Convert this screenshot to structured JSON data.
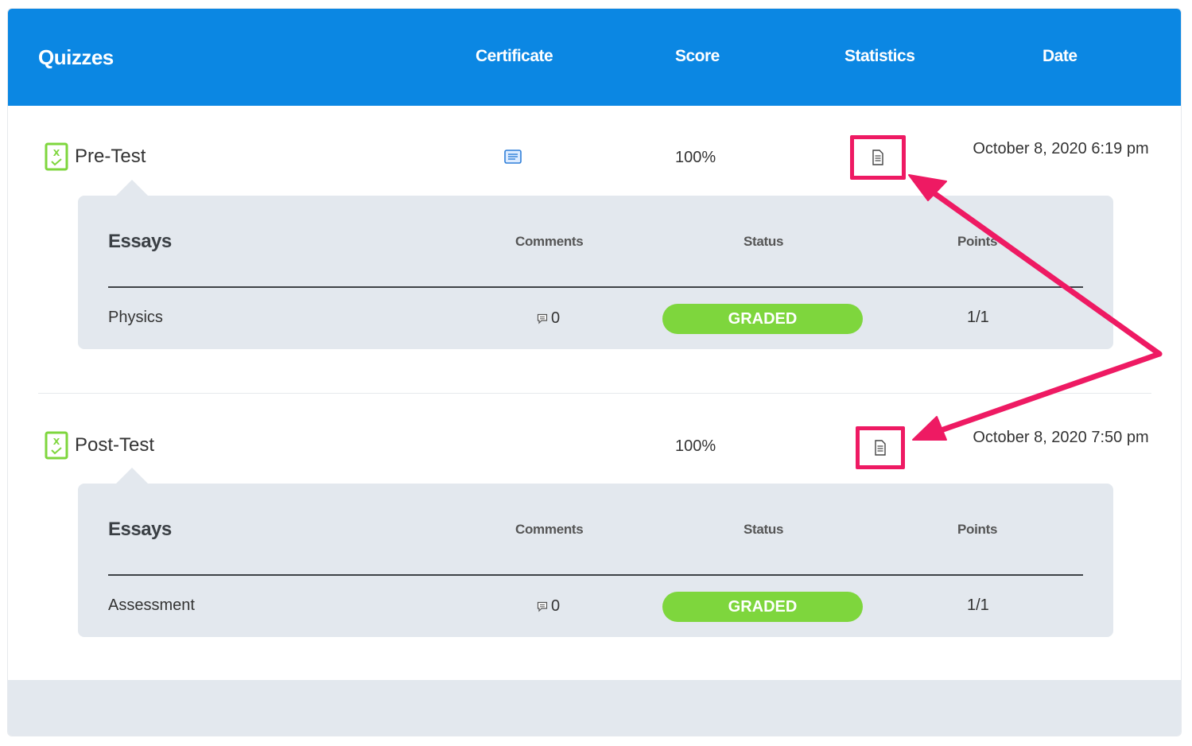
{
  "header": {
    "title": "Quizzes",
    "col_certificate": "Certificate",
    "col_score": "Score",
    "col_statistics": "Statistics",
    "col_date": "Date"
  },
  "quizzes": [
    {
      "name": "Pre-Test",
      "has_certificate": true,
      "score": "100%",
      "date": "October 8, 2020 6:19 pm",
      "essays": {
        "title": "Essays",
        "col_comments": "Comments",
        "col_status": "Status",
        "col_points": "Points",
        "rows": [
          {
            "name": "Physics",
            "comments": "0",
            "status": "GRADED",
            "points": "1/1"
          }
        ]
      }
    },
    {
      "name": "Post-Test",
      "has_certificate": false,
      "score": "100%",
      "date": "October 8, 2020 7:50 pm",
      "essays": {
        "title": "Essays",
        "col_comments": "Comments",
        "col_status": "Status",
        "col_points": "Points",
        "rows": [
          {
            "name": "Assessment",
            "comments": "0",
            "status": "GRADED",
            "points": "1/1"
          }
        ]
      }
    }
  ],
  "colors": {
    "header_bg": "#0b87e3",
    "badge_bg": "#7ed63d",
    "highlight": "#ee1a63",
    "essay_bg": "#e3e8ee"
  }
}
